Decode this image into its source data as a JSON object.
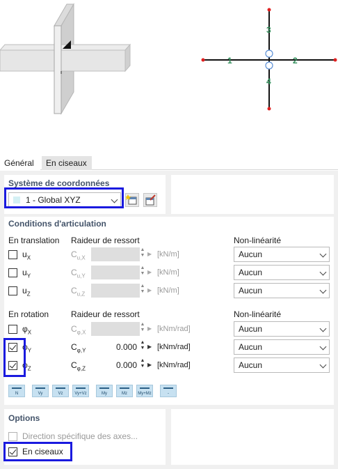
{
  "tabs": [
    {
      "label": "Général",
      "active": true
    },
    {
      "label": "En ciseaux",
      "active": false
    }
  ],
  "preview": {
    "axis_labels": [
      "1",
      "2",
      "3",
      "4"
    ]
  },
  "coord_system": {
    "title": "Système de coordonnées",
    "selected": "1 - Global XYZ"
  },
  "conditions": {
    "title": "Conditions d'articulation",
    "translation_header": "En translation",
    "rotation_header": "En rotation",
    "spring_header": "Raideur de ressort",
    "nonlin_header": "Non-linéarité",
    "translation_rows": [
      {
        "label_main": "u",
        "label_sub": "X",
        "sym_main": "C",
        "sym_sub": "u,X",
        "checked": false,
        "value": "",
        "unit": "[kN/m]",
        "nonlin": "Aucun"
      },
      {
        "label_main": "u",
        "label_sub": "Y",
        "sym_main": "C",
        "sym_sub": "u,Y",
        "checked": false,
        "value": "",
        "unit": "[kN/m]",
        "nonlin": "Aucun"
      },
      {
        "label_main": "u",
        "label_sub": "Z",
        "sym_main": "C",
        "sym_sub": "u,Z",
        "checked": false,
        "value": "",
        "unit": "[kN/m]",
        "nonlin": "Aucun"
      }
    ],
    "rotation_rows": [
      {
        "label_main": "φ",
        "label_sub": "X",
        "sym_main": "C",
        "sym_sub": "φ,X",
        "checked": false,
        "value": "",
        "unit": "[kNm/rad]",
        "nonlin": "Aucun"
      },
      {
        "label_main": "φ",
        "label_sub": "Y",
        "sym_main": "C",
        "sym_sub": "φ,Y",
        "checked": true,
        "value": "0.000",
        "unit": "[kNm/rad]",
        "nonlin": "Aucun"
      },
      {
        "label_main": "φ",
        "label_sub": "Z",
        "sym_main": "C",
        "sym_sub": "φ,Z",
        "checked": true,
        "value": "0.000",
        "unit": "[kNm/rad]",
        "nonlin": "Aucun"
      }
    ],
    "toolbar": [
      {
        "label": "N"
      },
      {
        "label": "Vy"
      },
      {
        "label": "Vz"
      },
      {
        "label": "Vy+Vz"
      },
      {
        "label": "My"
      },
      {
        "label": "Mz"
      },
      {
        "label": "My+Mz"
      },
      {
        "label": "-"
      }
    ]
  },
  "options": {
    "title": "Options",
    "axes_direction_label": "Direction spécifique des axes...",
    "axes_direction_checked": false,
    "scissors_label": "En ciseaux",
    "scissors_checked": true
  },
  "colors": {
    "highlight": "#1a1adf",
    "panel_title": "#44546a",
    "axis_label": "#2e8b57",
    "axis_point": "#e02020",
    "button_fill": "#c7e1f1"
  }
}
